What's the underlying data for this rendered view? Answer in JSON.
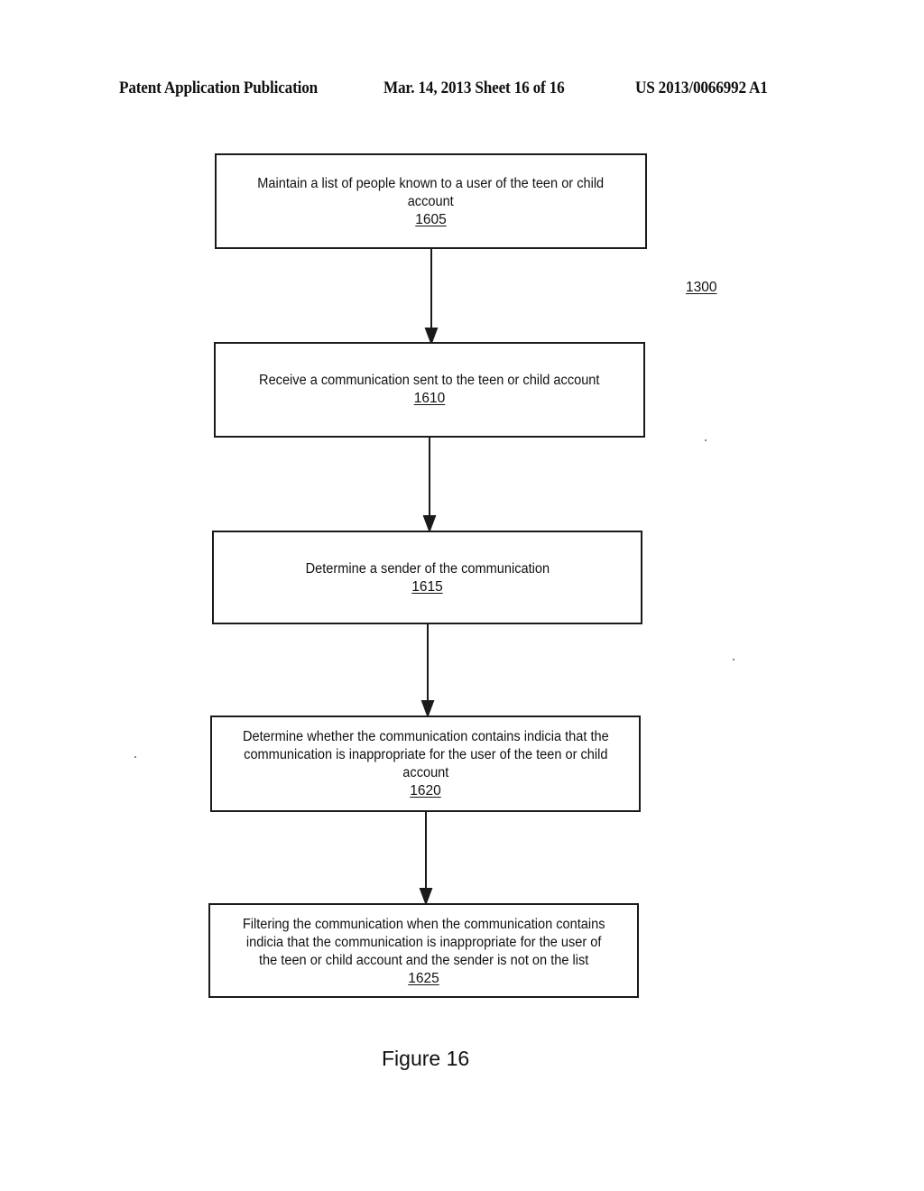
{
  "header": {
    "publication": "Patent Application Publication",
    "date_sheet": "Mar. 14, 2013  Sheet 16 of 16",
    "patent_number": "US 2013/0066992 A1"
  },
  "diagram": {
    "reference_label": "1300",
    "steps": [
      {
        "text": "Maintain a list of people known to a user of the teen or child\naccount",
        "ref": "1605"
      },
      {
        "text": "Receive a communication sent to the teen or child account",
        "ref": "1610"
      },
      {
        "text": "Determine a sender of the communication",
        "ref": "1615"
      },
      {
        "text": "Determine whether the communication contains indicia that the\ncommunication is inappropriate for the user of the teen or child\naccount",
        "ref": "1620"
      },
      {
        "text": "Filtering the communication when the communication contains\nindicia that the communication is inappropriate for the user of\nthe teen or child account and the sender is not on the list",
        "ref": "1625"
      }
    ],
    "connections": [
      {
        "from": "1605",
        "to": "1610"
      },
      {
        "from": "1610",
        "to": "1615"
      },
      {
        "from": "1615",
        "to": "1620"
      },
      {
        "from": "1620",
        "to": "1625"
      }
    ]
  },
  "caption": "Figure 16"
}
